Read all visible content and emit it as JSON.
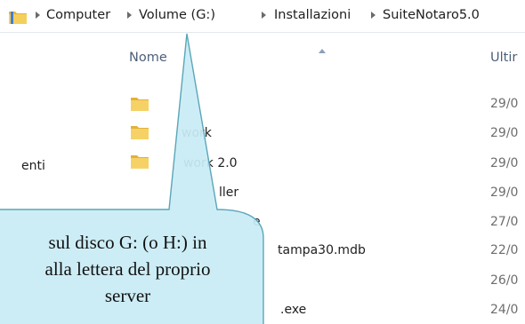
{
  "breadcrumb": [
    "Computer",
    "Volume (G:)",
    "Installazioni",
    "SuiteNotaro5.0"
  ],
  "columns": {
    "name": "Nome",
    "modified": "Ultir"
  },
  "nav_pane_item": "enti",
  "files": [
    {
      "name": "",
      "date": "29/0"
    },
    {
      "name": "work",
      "date": "29/0"
    },
    {
      "name": "work 2.0",
      "date": "29/0"
    },
    {
      "name": "ller",
      "date": "29/0"
    },
    {
      "name": "e",
      "date": "27/0"
    },
    {
      "name": "tampa30.mdb",
      "date": "22/0"
    },
    {
      "name": "",
      "date": "26/0"
    },
    {
      "name": ".exe",
      "date": "24/0"
    }
  ],
  "callout": {
    "lines": [
      "sul disco G: (o H:) in",
      "alla lettera del proprio",
      "server"
    ],
    "fill": "#c9ecf5",
    "border": "#5aa6b8"
  },
  "colors": {
    "folder": "#f2c64d",
    "header_text": "#4c607a",
    "date_text": "#6d6d6d"
  }
}
